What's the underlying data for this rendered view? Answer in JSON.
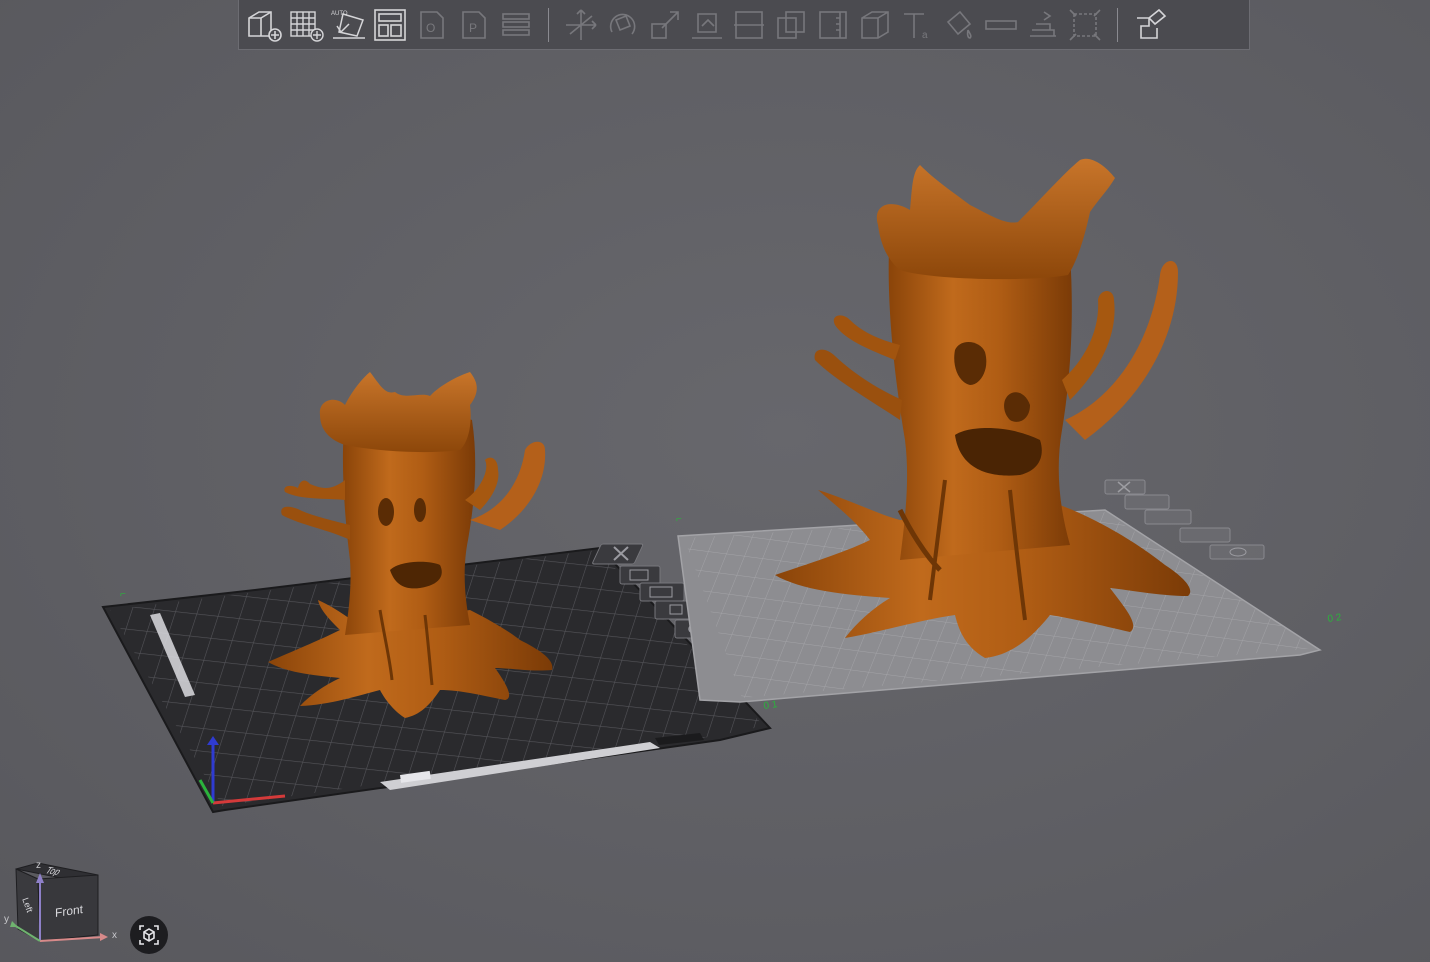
{
  "toolbar": {
    "tools": [
      {
        "name": "add-model",
        "icon": "cube-plus-icon",
        "enabled": true
      },
      {
        "name": "add-plate",
        "icon": "grid-plus-icon",
        "enabled": true
      },
      {
        "name": "auto-orient",
        "icon": "auto-orient-icon",
        "enabled": true,
        "badge": "AUTO"
      },
      {
        "name": "arrange",
        "icon": "arrange-layout-icon",
        "enabled": true
      },
      {
        "name": "split-objects",
        "icon": "split-objects-icon",
        "enabled": false
      },
      {
        "name": "split-parts",
        "icon": "split-parts-icon",
        "enabled": false
      },
      {
        "name": "layers",
        "icon": "layers-icon",
        "enabled": false
      },
      {
        "name": "move",
        "icon": "move-icon",
        "enabled": false
      },
      {
        "name": "rotate",
        "icon": "rotate-icon",
        "enabled": false
      },
      {
        "name": "scale",
        "icon": "scale-icon",
        "enabled": false
      },
      {
        "name": "lay-on-face",
        "icon": "lay-on-face-icon",
        "enabled": false
      },
      {
        "name": "cut",
        "icon": "cut-icon",
        "enabled": false
      },
      {
        "name": "boolean",
        "icon": "boolean-icon",
        "enabled": false
      },
      {
        "name": "measure",
        "icon": "measure-icon",
        "enabled": false
      },
      {
        "name": "support-paint",
        "icon": "support-paint-icon",
        "enabled": false
      },
      {
        "name": "text",
        "icon": "text-icon",
        "enabled": false
      },
      {
        "name": "color-paint",
        "icon": "color-paint-icon",
        "enabled": false
      },
      {
        "name": "seam-paint",
        "icon": "seam-paint-icon",
        "enabled": false
      },
      {
        "name": "brim-ears",
        "icon": "brim-ears-icon",
        "enabled": false
      },
      {
        "name": "fuzzy-skin",
        "icon": "fuzzy-skin-icon",
        "enabled": false
      },
      {
        "name": "assembly-view",
        "icon": "assembly-view-icon",
        "enabled": true
      }
    ]
  },
  "plates": [
    {
      "name": "plate-1",
      "state": "selected",
      "surface": "#2b2b2e",
      "grid": "#5a5a5e"
    },
    {
      "name": "plate-2",
      "state": "unselected",
      "surface": "#8b8b8f",
      "grid": "#a6a6aa"
    }
  ],
  "plate_tools": [
    {
      "name": "delete-plate",
      "icon": "close-x-icon"
    },
    {
      "name": "orient-plate",
      "icon": "orient-icon"
    },
    {
      "name": "arrange-plate",
      "icon": "arrange-icon"
    },
    {
      "name": "lock-plate",
      "icon": "lock-icon"
    },
    {
      "name": "plate-settings",
      "icon": "gear-icon"
    }
  ],
  "plate_numbers": [
    "01",
    "02"
  ],
  "model_color": "#b05d14",
  "nav_cube": {
    "front": "Front",
    "top": "Top",
    "left": "Left",
    "axis_x": "x",
    "axis_y": "y",
    "axis_z": "z"
  },
  "colors": {
    "background": "#5f5f64",
    "toolbar": "#4b4b50",
    "axis_x": "#d43a3a",
    "axis_y": "#2bb33c",
    "axis_z": "#2f3bd1"
  }
}
